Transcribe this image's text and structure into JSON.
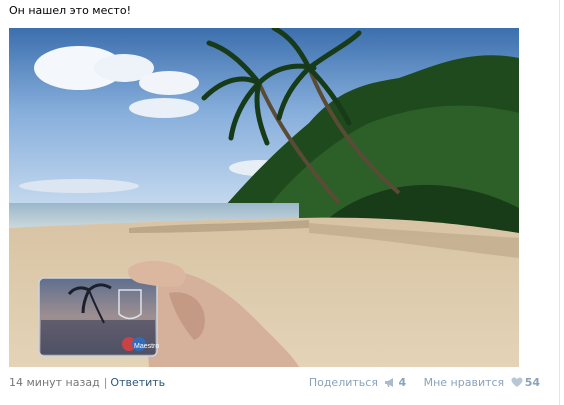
{
  "post": {
    "text": "Он нашел это место!"
  },
  "footer": {
    "timestamp": "14 минут назад",
    "separator": "|",
    "reply_label": "Ответить",
    "share_label": "Поделиться",
    "share_count": "4",
    "like_label": "Мне нравится",
    "like_count": "54"
  },
  "photo_text": {
    "card_brand": "Maestro"
  },
  "colors": {
    "link": "#2b587a",
    "muted_link": "#89a3ba",
    "timestamp": "#777777"
  },
  "icons": {
    "share": "megaphone-icon",
    "like": "heart-icon"
  }
}
